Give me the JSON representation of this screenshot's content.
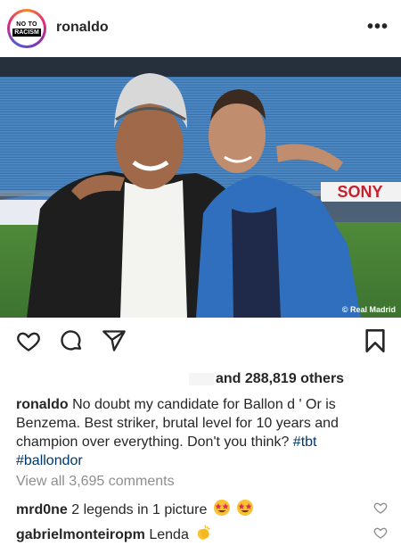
{
  "post": {
    "avatar_text_top": "NO TO",
    "avatar_text_bottom": "RACISM",
    "username": "ronaldo",
    "more_icon": "more-horizontal-icon",
    "photo_watermark": "© Real Madrid",
    "photo_sign_text": "SONY",
    "likes_text": "and 288,819 others",
    "caption": {
      "username": "ronaldo",
      "text": "No doubt my candidate for Ballon d ' Or is Benzema. Best striker, brutal level for 10 years and champion over everything. Don't you think?",
      "hashtag1": "#tbt",
      "hashtag2": "#ballondor"
    },
    "view_all_comments": "View all 3,695 comments",
    "comments": [
      {
        "username": "mrd0ne",
        "text": "2 legends in 1 picture"
      },
      {
        "username": "gabrielmonteiropm",
        "text": "Lenda"
      }
    ]
  },
  "icons": {
    "like": "heart-icon",
    "comment": "comment-icon",
    "share": "paper-plane-icon",
    "save": "bookmark-icon"
  }
}
